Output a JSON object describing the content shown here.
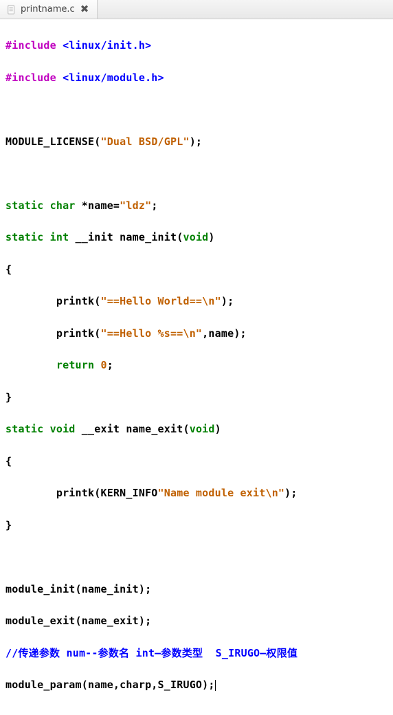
{
  "tab": {
    "filename": "printname.c",
    "close_glyph": "✖",
    "icon_name": "file-icon"
  },
  "code": {
    "l1_pp": "#include ",
    "l1_inc": "<linux/init.h>",
    "l2_pp": "#include ",
    "l2_inc": "<linux/module.h>",
    "l4_a": "MODULE_LICENSE(",
    "l4_s": "\"Dual BSD/GPL\"",
    "l4_b": ");",
    "l6_kw": "static char ",
    "l6_id": "*name=",
    "l6_s": "\"ldz\"",
    "l6_end": ";",
    "l7_kw": "static int ",
    "l7_id": "__init name_init(",
    "l7_kw2": "void",
    "l7_end": ")",
    "l8": "{",
    "l9_ind": "        printk(",
    "l9_s": "\"==Hello World==\\n\"",
    "l9_end": ");",
    "l10_ind": "        printk(",
    "l10_s": "\"==Hello %s==\\n\"",
    "l10_end": ",name);",
    "l11_ind": "        ",
    "l11_kw": "return ",
    "l11_num": "0",
    "l11_end": ";",
    "l12": "}",
    "l13_kw": "static void ",
    "l13_id": "__exit name_exit(",
    "l13_kw2": "void",
    "l13_end": ")",
    "l14": "{",
    "l15_ind": "        printk(KERN_INFO",
    "l15_s": "\"Name module exit\\n\"",
    "l15_end": ");",
    "l16": "}",
    "l18": "module_init(name_init);",
    "l19": "module_exit(name_exit);",
    "l20_cmt": "//传递参数 num--参数名 int—参数类型  S_IRUGO—权限值",
    "l21": "module_param(name,charp,S_IRUGO);"
  }
}
